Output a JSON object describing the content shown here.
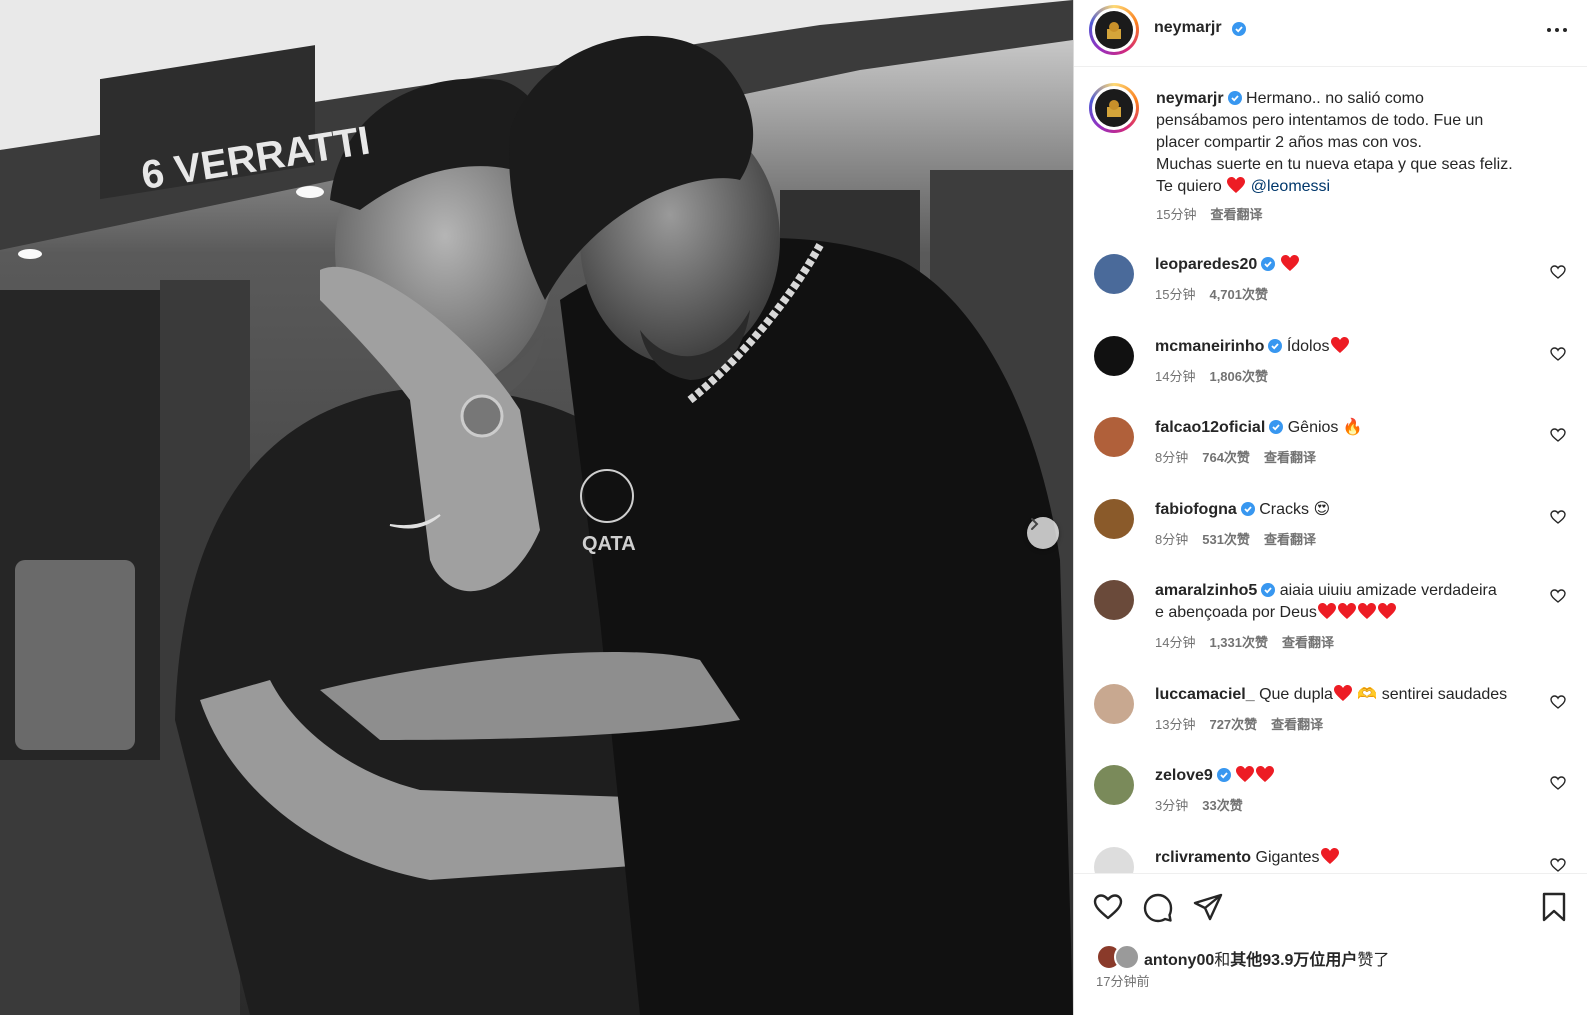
{
  "post": {
    "author": "neymarjr",
    "more_label": "...",
    "next_label": "›"
  },
  "caption": {
    "username": "neymarjr",
    "line1": "Hermano.. no salió como",
    "line2": "pensábamos pero intentamos de todo. Fue un",
    "line3": "placer compartir 2 años mas con vos.",
    "line4": "Muchas suerte en tu nueva etapa y que seas feliz.",
    "line5_pre": "Te quiero",
    "mention": "@leomessi",
    "time": "15分钟",
    "translate": "查看翻译"
  },
  "comments": [
    {
      "user": "leoparedes20",
      "verified": true,
      "text": "",
      "hearts": 1,
      "time": "15分钟",
      "likes": "4,701次赞",
      "translate": ""
    },
    {
      "user": "mcmaneirinho",
      "verified": true,
      "text": "Ídolos",
      "hearts": 1,
      "time": "14分钟",
      "likes": "1,806次赞",
      "translate": ""
    },
    {
      "user": "falcao12oficial",
      "verified": true,
      "text": "Gênios 🔥",
      "hearts": 0,
      "time": "8分钟",
      "likes": "764次赞",
      "translate": "查看翻译"
    },
    {
      "user": "fabiofogna",
      "verified": true,
      "text": "Cracks 😍",
      "hearts": 0,
      "time": "8分钟",
      "likes": "531次赞",
      "translate": "查看翻译"
    },
    {
      "user": "amaralzinho5",
      "verified": true,
      "text": "aiaia uiuiu amizade verdadeira",
      "text2": "e abençoada por Deus",
      "hearts": 4,
      "time": "14分钟",
      "likes": "1,331次赞",
      "translate": "查看翻译"
    },
    {
      "user": "luccamaciel_",
      "verified": false,
      "text": "Que dupla",
      "text_after": "🫶 sentirei saudades",
      "hearts": 1,
      "time": "13分钟",
      "likes": "727次赞",
      "translate": "查看翻译"
    },
    {
      "user": "zelove9",
      "verified": true,
      "text": "",
      "hearts": 2,
      "time": "3分钟",
      "likes": "33次赞",
      "translate": ""
    },
    {
      "user": "rclivramento",
      "verified": false,
      "text": "Gigantes",
      "hearts": 1,
      "time": "",
      "likes": "",
      "translate": ""
    }
  ],
  "footer": {
    "likes_user": "antony00",
    "likes_joiner": "和",
    "likes_others": "其他93.9万位用户",
    "likes_suffix": "赞了",
    "time_ago": "17分钟前"
  },
  "icons": {
    "like": "heart-outline-icon",
    "comment": "comment-bubble-icon",
    "share": "paper-plane-icon",
    "save": "bookmark-icon",
    "verified": "verified-badge-icon"
  },
  "colors": {
    "verified": "#3897f0",
    "heart": "#ed1c24",
    "link": "#00376b",
    "muted": "#737373"
  }
}
